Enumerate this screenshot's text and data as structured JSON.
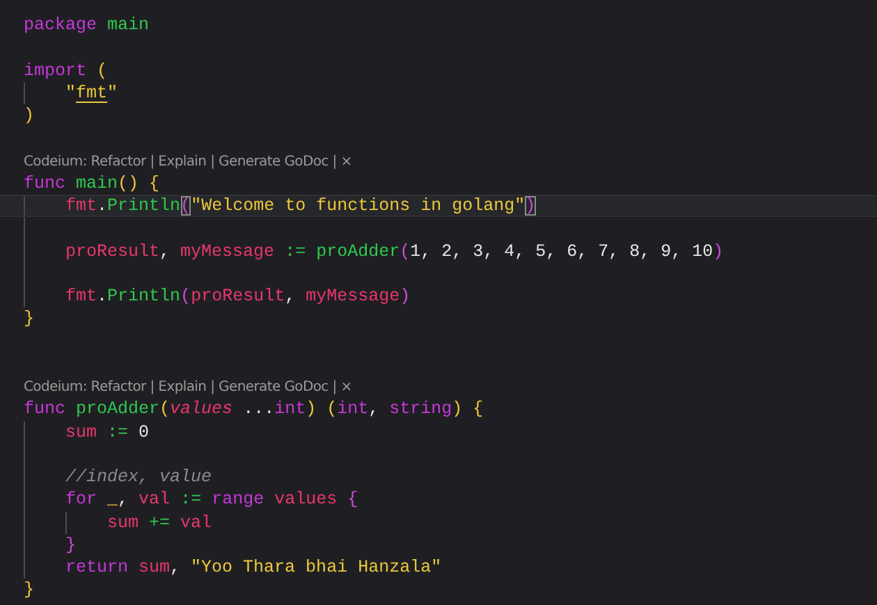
{
  "editor": {
    "lines": [
      {
        "kind": "code",
        "current": false,
        "tokens": [
          {
            "text": "package ",
            "kind": "keyword"
          },
          {
            "text": "main",
            "kind": "function"
          }
        ]
      },
      {
        "kind": "blank"
      },
      {
        "kind": "code",
        "current": false,
        "tokens": [
          {
            "text": "import ",
            "kind": "keyword"
          },
          {
            "text": "(",
            "kind": "bracket1"
          }
        ]
      },
      {
        "kind": "code",
        "current": false,
        "tokens": [
          {
            "text": "    \"",
            "kind": "string"
          },
          {
            "text": "fmt",
            "kind": "import-path"
          },
          {
            "text": "\"",
            "kind": "string"
          }
        ]
      },
      {
        "kind": "code",
        "current": false,
        "tokens": [
          {
            "text": ")",
            "kind": "bracket1"
          }
        ]
      },
      {
        "kind": "blank"
      },
      {
        "kind": "lens",
        "text": "Codeium: Refactor | Explain | Generate GoDoc | ×"
      },
      {
        "kind": "code",
        "current": false,
        "tokens": [
          {
            "text": "func ",
            "kind": "keyword"
          },
          {
            "text": "main",
            "kind": "function"
          },
          {
            "text": "() {",
            "kind": "bracket1"
          }
        ]
      },
      {
        "kind": "code",
        "current": true,
        "tokens": [
          {
            "text": "    fmt",
            "kind": "variable"
          },
          {
            "text": ".",
            "kind": "plain"
          },
          {
            "text": "Println",
            "kind": "function"
          },
          {
            "text": "(",
            "kind": "bracket-match"
          },
          {
            "text": "\"Welcome to functions in golang\"",
            "kind": "string"
          },
          {
            "text": ")",
            "kind": "bracket-match"
          }
        ]
      },
      {
        "kind": "blank"
      },
      {
        "kind": "code",
        "current": false,
        "tokens": [
          {
            "text": "    proResult",
            "kind": "variable"
          },
          {
            "text": ", ",
            "kind": "plain"
          },
          {
            "text": "myMessage ",
            "kind": "variable"
          },
          {
            "text": ":= ",
            "kind": "operator"
          },
          {
            "text": "proAdder",
            "kind": "function"
          },
          {
            "text": "(",
            "kind": "bracket2"
          },
          {
            "text": "1, 2, 3, 4, 5, 6, 7, 8, 9, 10",
            "kind": "plain"
          },
          {
            "text": ")",
            "kind": "bracket2"
          }
        ]
      },
      {
        "kind": "blank"
      },
      {
        "kind": "code",
        "current": false,
        "tokens": [
          {
            "text": "    fmt",
            "kind": "variable"
          },
          {
            "text": ".",
            "kind": "plain"
          },
          {
            "text": "Println",
            "kind": "function"
          },
          {
            "text": "(",
            "kind": "bracket2"
          },
          {
            "text": "proResult",
            "kind": "variable"
          },
          {
            "text": ", ",
            "kind": "plain"
          },
          {
            "text": "myMessage",
            "kind": "variable"
          },
          {
            "text": ")",
            "kind": "bracket2"
          }
        ]
      },
      {
        "kind": "code",
        "current": false,
        "tokens": [
          {
            "text": "}",
            "kind": "bracket1"
          }
        ]
      },
      {
        "kind": "blank"
      },
      {
        "kind": "blank"
      },
      {
        "kind": "lens",
        "text": "Codeium: Refactor | Explain | Generate GoDoc | ×"
      },
      {
        "kind": "code",
        "current": false,
        "tokens": [
          {
            "text": "func ",
            "kind": "keyword"
          },
          {
            "text": "proAdder",
            "kind": "function"
          },
          {
            "text": "(",
            "kind": "bracket1"
          },
          {
            "text": "values",
            "kind": "param"
          },
          {
            "text": " ...",
            "kind": "plain"
          },
          {
            "text": "int",
            "kind": "keyword"
          },
          {
            "text": ") (",
            "kind": "bracket1"
          },
          {
            "text": "int",
            "kind": "keyword"
          },
          {
            "text": ", ",
            "kind": "plain"
          },
          {
            "text": "string",
            "kind": "keyword"
          },
          {
            "text": ") {",
            "kind": "bracket1"
          }
        ]
      },
      {
        "kind": "code",
        "current": false,
        "tokens": [
          {
            "text": "    sum ",
            "kind": "variable"
          },
          {
            "text": ":= ",
            "kind": "operator"
          },
          {
            "text": "0",
            "kind": "plain"
          }
        ]
      },
      {
        "kind": "blank"
      },
      {
        "kind": "code",
        "current": false,
        "tokens": [
          {
            "text": "    //index, value",
            "kind": "comment"
          }
        ]
      },
      {
        "kind": "code",
        "current": false,
        "tokens": [
          {
            "text": "    for ",
            "kind": "keyword"
          },
          {
            "text": "_",
            "kind": "bracket1"
          },
          {
            "text": ", ",
            "kind": "plain"
          },
          {
            "text": "val ",
            "kind": "variable"
          },
          {
            "text": ":= ",
            "kind": "operator"
          },
          {
            "text": "range ",
            "kind": "keyword"
          },
          {
            "text": "values ",
            "kind": "variable"
          },
          {
            "text": "{",
            "kind": "bracket2"
          }
        ]
      },
      {
        "kind": "code",
        "current": false,
        "tokens": [
          {
            "text": "        sum ",
            "kind": "variable"
          },
          {
            "text": "+= ",
            "kind": "operator"
          },
          {
            "text": "val",
            "kind": "variable"
          }
        ]
      },
      {
        "kind": "code",
        "current": false,
        "tokens": [
          {
            "text": "    }",
            "kind": "bracket2"
          }
        ]
      },
      {
        "kind": "code",
        "current": false,
        "tokens": [
          {
            "text": "    return ",
            "kind": "keyword"
          },
          {
            "text": "sum",
            "kind": "variable"
          },
          {
            "text": ", ",
            "kind": "plain"
          },
          {
            "text": "\"Yoo Thara bhai Hanzala\"",
            "kind": "string"
          }
        ]
      },
      {
        "kind": "code",
        "current": false,
        "tokens": [
          {
            "text": "}",
            "kind": "bracket1"
          }
        ]
      }
    ]
  }
}
